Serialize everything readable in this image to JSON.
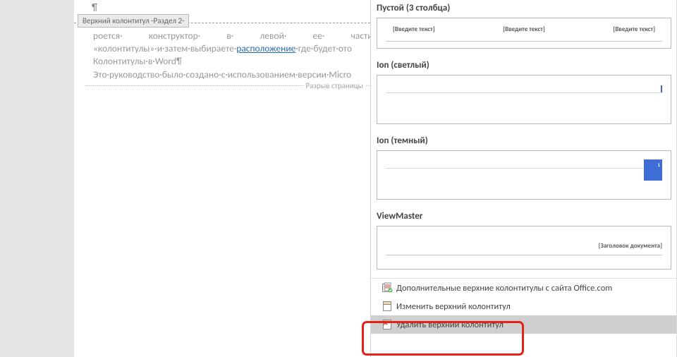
{
  "document": {
    "pilcrow": "¶",
    "header_tag": "Верхний колонтитул -Раздел 2-",
    "body_line1_before": "роется· конструктор· в· левой· ее· части·",
    "body_line2_before": "«колонтитулы»·и·затем·выбираете·",
    "body_line2_link": "расположение",
    "body_line2_after": "·где·будет·ото",
    "body_line3": "Колонтитулы·в·Word¶",
    "body_line4": "Это·руководство·было·создано·с·использованием·версии·Micro",
    "page_break_label": "Разрыв страницы"
  },
  "gallery": {
    "group_empty3": {
      "title": "Пустой (3 столбца)",
      "col1": "[Введите текст]",
      "col2": "[Введите текст]",
      "col3": "[Введите текст]"
    },
    "group_ion_light": {
      "title": "Ion (светлый)"
    },
    "group_ion_dark": {
      "title": "Ion (темный)",
      "tiny": "1"
    },
    "group_viewmaster": {
      "title": "ViewMaster",
      "doc_title": "[Заголовок документа]"
    }
  },
  "menu": {
    "more_office": "Дополнительные верхние колонтитулы с сайта Office.com",
    "edit_header": "Изменить верхний колонтитул",
    "remove_header": "Удалить верхний колонтитул"
  }
}
